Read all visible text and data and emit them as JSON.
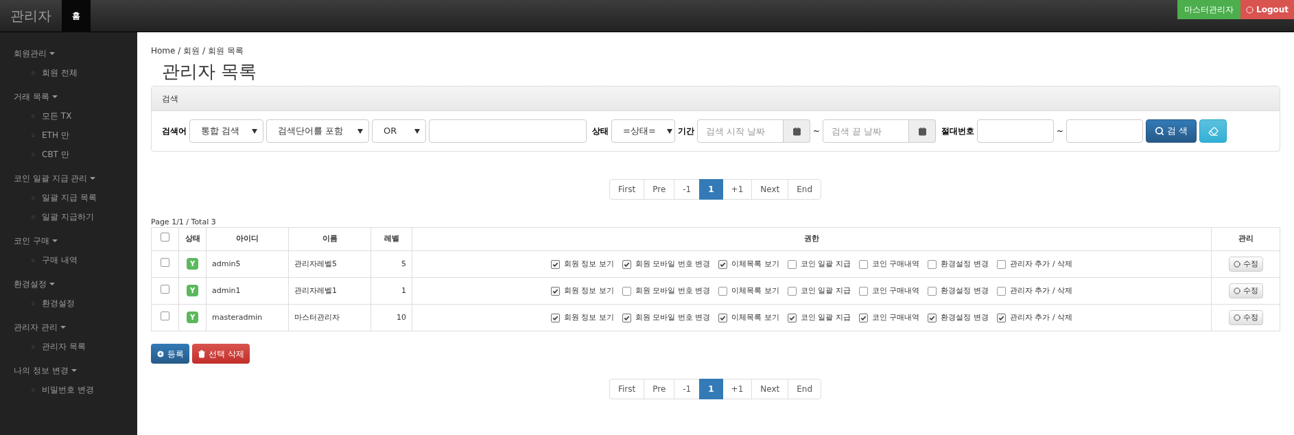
{
  "brand": "관리자",
  "nav_tabs": [
    {
      "label": "홈",
      "selected": true
    }
  ],
  "top_buttons": [
    {
      "label": "마스터관리자",
      "kind": "user"
    },
    {
      "label": "Logout",
      "kind": "logout"
    }
  ],
  "sidebar": [
    {
      "label": "회원관리",
      "expanded": true,
      "children": [
        {
          "label": "회원 전체"
        }
      ]
    },
    {
      "label": "거래 목록",
      "expanded": true,
      "children": [
        {
          "label": "모든 TX"
        },
        {
          "label": "ETH 만"
        },
        {
          "label": "CBT 만"
        }
      ]
    },
    {
      "label": "코인 일괄 지급 관리",
      "expanded": true,
      "children": [
        {
          "label": "일괄 지급 목록"
        },
        {
          "label": "일괄 지급하기"
        }
      ]
    },
    {
      "label": "코인 구매",
      "expanded": true,
      "children": [
        {
          "label": "구매 내역"
        }
      ]
    },
    {
      "label": "환경설정",
      "expanded": true,
      "children": [
        {
          "label": "환경설정"
        }
      ]
    },
    {
      "label": "관리자 관리",
      "expanded": true,
      "children": [
        {
          "label": "관리자 목록"
        }
      ]
    },
    {
      "label": "나의 정보 변경",
      "expanded": true,
      "children": [
        {
          "label": "비밀번호 변경"
        }
      ]
    }
  ],
  "breadcrumb": "Home / 회원 / 회원 목록",
  "page_title": "관리자 목록",
  "search": {
    "title": "검색",
    "keyword_label": "검색어",
    "selects": [
      "통합 검색",
      "검색단어를 포함",
      "OR"
    ],
    "status_label": "상태",
    "status_select": "=상태=",
    "period_label": "기간",
    "start_placeholder": "검색 시작 날짜",
    "tilde": "~",
    "end_placeholder": "검색 끝 날짜",
    "number_label": "절대번호",
    "tilde2": "~",
    "search_button": "검 색"
  },
  "pagination_top": [
    {
      "label": "First",
      "selected": false
    },
    {
      "label": "Pre",
      "selected": false
    },
    {
      "label": "-1",
      "selected": false
    },
    {
      "label": "1",
      "selected": true
    },
    {
      "label": "+1",
      "selected": false
    },
    {
      "label": "Next",
      "selected": false
    },
    {
      "label": "End",
      "selected": false
    }
  ],
  "page_info": "Page 1/1 / Total 3",
  "table": {
    "header_checked": false,
    "columns": [
      "상태",
      "아이디",
      "이름",
      "레벨",
      "권한",
      "관리"
    ],
    "rows": [
      {
        "checked": false,
        "status": "Y",
        "id": "admin5",
        "name": "관리자레벨5",
        "level_text": "5",
        "edit": "수정",
        "permissions": [
          {
            "label": "회원 정보 보기",
            "checked": true
          },
          {
            "label": "회원 모바일 번호 변경",
            "checked": true
          },
          {
            "label": "이체목록 보기",
            "checked": true
          },
          {
            "label": "코인 일괄 지급",
            "checked": false
          },
          {
            "label": "코인 구매내역",
            "checked": false
          },
          {
            "label": "환경설정 변경",
            "checked": false
          },
          {
            "label": "관리자 추가 / 삭제",
            "checked": false
          }
        ]
      },
      {
        "checked": false,
        "status": "Y",
        "id": "admin1",
        "name": "관리자레벨1",
        "level_text": "1",
        "edit": "수정",
        "permissions": [
          {
            "label": "회원 정보 보기",
            "checked": true
          },
          {
            "label": "회원 모바일 번호 변경",
            "checked": false
          },
          {
            "label": "이체목록 보기",
            "checked": false
          },
          {
            "label": "코인 일괄 지급",
            "checked": false
          },
          {
            "label": "코인 구매내역",
            "checked": false
          },
          {
            "label": "환경설정 변경",
            "checked": false
          },
          {
            "label": "관리자 추가 / 삭제",
            "checked": false
          }
        ]
      },
      {
        "checked": false,
        "status": "Y",
        "id": "masteradmin",
        "name": "마스터관리자",
        "level_text": "10",
        "edit": "수정",
        "permissions": [
          {
            "label": "회원 정보 보기",
            "checked": true
          },
          {
            "label": "회원 모바일 번호 변경",
            "checked": true
          },
          {
            "label": "이체목록 보기",
            "checked": true
          },
          {
            "label": "코인 일괄 지급",
            "checked": true
          },
          {
            "label": "코인 구매내역",
            "checked": true
          },
          {
            "label": "환경설정 변경",
            "checked": true
          },
          {
            "label": "관리자 추가 / 삭제",
            "checked": true
          }
        ]
      }
    ]
  },
  "actions": [
    {
      "label": "등록",
      "kind": "add"
    },
    {
      "label": "선택 삭제",
      "kind": "delete"
    }
  ],
  "pagination_bottom": [
    {
      "label": "First",
      "selected": false
    },
    {
      "label": "Pre",
      "selected": false
    },
    {
      "label": "-1",
      "selected": false
    },
    {
      "label": "1",
      "selected": true
    },
    {
      "label": "+1",
      "selected": false
    },
    {
      "label": "Next",
      "selected": false
    },
    {
      "label": "End",
      "selected": false
    }
  ]
}
